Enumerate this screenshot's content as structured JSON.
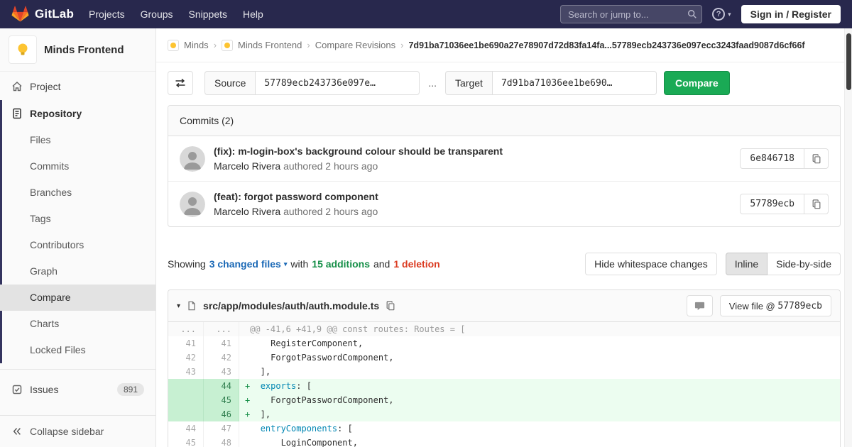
{
  "colors": {
    "navbar_bg": "#28284d",
    "accent_green": "#1aaa55",
    "additions_green": "#168f48",
    "deletions_red": "#db3b21",
    "link_blue": "#1b69b6",
    "added_line_bg": "#ecfdf0",
    "added_linenum_bg": "#c7f0d2",
    "sidebar_bg": "#fafafa"
  },
  "icons": {
    "question": "?",
    "chevron_down": "▾",
    "breadcrumb_separator": "›"
  },
  "navbar": {
    "logo_text": "GitLab",
    "links": [
      "Projects",
      "Groups",
      "Snippets",
      "Help"
    ],
    "search_placeholder": "Search or jump to...",
    "sign_in_label": "Sign in / Register"
  },
  "sidebar": {
    "project_title": "Minds Frontend",
    "project_item": "Project",
    "repository_item": "Repository",
    "repository_subitems": [
      "Files",
      "Commits",
      "Branches",
      "Tags",
      "Contributors",
      "Graph",
      "Compare",
      "Charts",
      "Locked Files"
    ],
    "active_subitem": "Compare",
    "issues_item": "Issues",
    "issues_count": "891",
    "collapse_label": "Collapse sidebar"
  },
  "breadcrumbs": {
    "group": "Minds",
    "project": "Minds Frontend",
    "page": "Compare Revisions",
    "current": "7d91ba71036ee1be690a27e78907d72d83fa14fa...57789ecb243736e097ecc3243faad9087d6cf66f"
  },
  "compare_form": {
    "source_label": "Source",
    "source_value": "57789ecb243736e097e…",
    "range_separator": "...",
    "target_label": "Target",
    "target_value": "7d91ba71036ee1be690…",
    "compare_button": "Compare"
  },
  "commits": {
    "header": "Commits (2)",
    "items": [
      {
        "title": "(fix): m-login-box's background colour should be transparent",
        "author": "Marcelo Rivera",
        "authored": "authored 2 hours ago",
        "sha": "6e846718"
      },
      {
        "title": "(feat): forgot password component",
        "author": "Marcelo Rivera",
        "authored": "authored 2 hours ago",
        "sha": "57789ecb"
      }
    ]
  },
  "diff_controls": {
    "showing": "Showing",
    "changed_files": "3 changed files",
    "with_word": "with",
    "additions": "15 additions",
    "and_word": "and",
    "deletions": "1 deletion",
    "hide_whitespace": "Hide whitespace changes",
    "inline": "Inline",
    "side_by_side": "Side-by-side"
  },
  "diff_file": {
    "path": "src/app/modules/auth/auth.module.ts",
    "view_file_label": "View file @",
    "view_file_sha": "57789ecb",
    "lines": [
      {
        "type": "match",
        "old": "...",
        "new": "...",
        "sign": "",
        "pre": "@@ -41,6 +41,9 @@ const routes: Routes = [",
        "key": "",
        "post": ""
      },
      {
        "type": "context",
        "old": "41",
        "new": "41",
        "sign": " ",
        "pre": "    RegisterComponent,",
        "key": "",
        "post": ""
      },
      {
        "type": "context",
        "old": "42",
        "new": "42",
        "sign": " ",
        "pre": "    ForgotPasswordComponent,",
        "key": "",
        "post": ""
      },
      {
        "type": "context",
        "old": "43",
        "new": "43",
        "sign": " ",
        "pre": "  ],",
        "key": "",
        "post": ""
      },
      {
        "type": "added",
        "old": "",
        "new": "44",
        "sign": "+",
        "pre": "  ",
        "key": "exports",
        "post": ": ["
      },
      {
        "type": "added",
        "old": "",
        "new": "45",
        "sign": "+",
        "pre": "    ForgotPasswordComponent,",
        "key": "",
        "post": ""
      },
      {
        "type": "added",
        "old": "",
        "new": "46",
        "sign": "+",
        "pre": "  ],",
        "key": "",
        "post": ""
      },
      {
        "type": "context",
        "old": "44",
        "new": "47",
        "sign": " ",
        "pre": "  ",
        "key": "entryComponents",
        "post": ": ["
      },
      {
        "type": "context",
        "old": "45",
        "new": "48",
        "sign": " ",
        "pre": "      LoginComponent,",
        "key": "",
        "post": ""
      }
    ]
  }
}
